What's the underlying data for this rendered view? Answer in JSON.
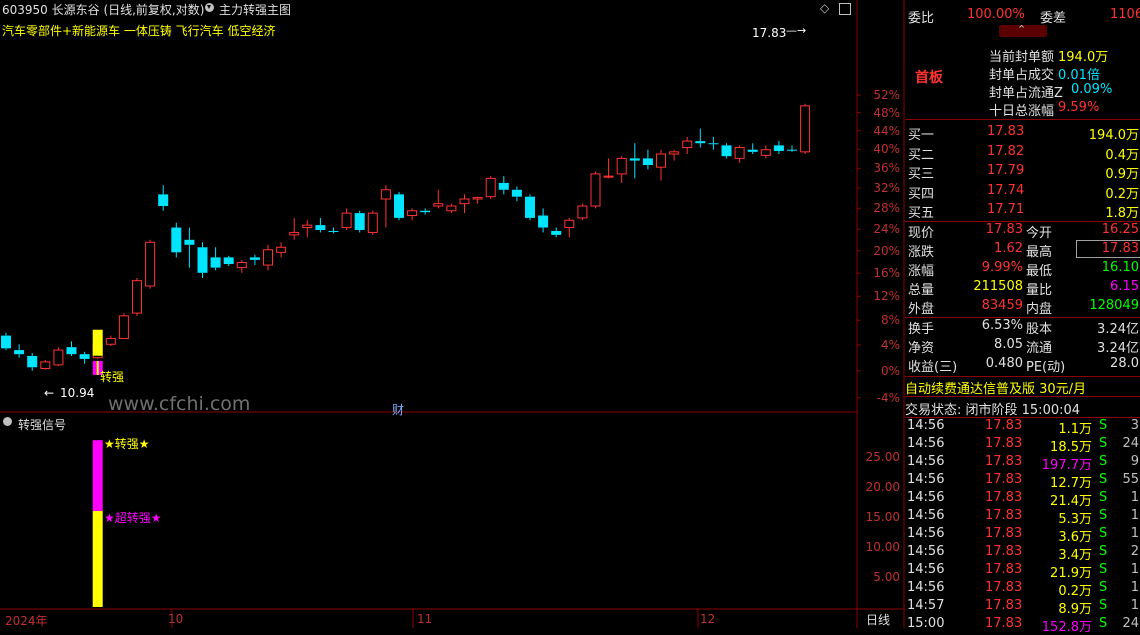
{
  "header": {
    "code_title": "603950 长源东谷 (日线,前复权,对数)",
    "indicator_name": "主力转强主图",
    "concepts": "汽车零部件+新能源车 一体压铸 飞行汽车 低空经济",
    "top_price_label": "17.83",
    "low_price_label": "10.94",
    "zhuanqiang_label": "转强",
    "watermark": "www.cfchi.com",
    "cai_marker": "财"
  },
  "price_axis": [
    "52%",
    "48%",
    "44%",
    "40%",
    "36%",
    "32%",
    "28%",
    "24%",
    "20%",
    "16%",
    "12%",
    "8%",
    "4%",
    "0%",
    "-4%"
  ],
  "sub_panel": {
    "title": "转强信号",
    "label_zhuanqiang": "★转强★",
    "label_chao": "★超转强★",
    "axis": [
      "25.00",
      "20.00",
      "15.00",
      "10.00",
      "5.00"
    ]
  },
  "x_axis": {
    "labels": [
      "2024年",
      "10",
      "11",
      "12"
    ],
    "period": "日线"
  },
  "colors": {
    "up": "#ff3232",
    "down": "#00e5ff",
    "signal_yellow": "#ffff00",
    "signal_magenta": "#ff00ff",
    "grid": "#8b0000"
  },
  "chart_data": {
    "type": "candlestick",
    "scale": "log",
    "ylim": [
      10.35,
      18.4
    ],
    "base_price": 10.9,
    "candles": [
      {
        "o": 11.5,
        "h": 11.55,
        "l": 11.25,
        "c": 11.28
      },
      {
        "o": 11.25,
        "h": 11.35,
        "l": 11.12,
        "c": 11.18
      },
      {
        "o": 11.15,
        "h": 11.2,
        "l": 10.9,
        "c": 10.96
      },
      {
        "o": 10.94,
        "h": 11.08,
        "l": 10.92,
        "c": 11.05
      },
      {
        "o": 11.0,
        "h": 11.3,
        "l": 10.98,
        "c": 11.25
      },
      {
        "o": 11.3,
        "h": 11.4,
        "l": 11.15,
        "c": 11.18
      },
      {
        "o": 11.18,
        "h": 11.22,
        "l": 11.02,
        "c": 11.1
      },
      {
        "o": 11.12,
        "h": 11.4,
        "l": 11.1,
        "c": 11.35
      },
      {
        "o": 11.35,
        "h": 11.5,
        "l": 11.32,
        "c": 11.45
      },
      {
        "o": 11.45,
        "h": 11.9,
        "l": 11.44,
        "c": 11.85
      },
      {
        "o": 11.9,
        "h": 12.55,
        "l": 11.85,
        "c": 12.5
      },
      {
        "o": 12.4,
        "h": 13.3,
        "l": 12.35,
        "c": 13.25
      },
      {
        "o": 14.25,
        "h": 14.45,
        "l": 13.9,
        "c": 14.0
      },
      {
        "o": 13.55,
        "h": 13.65,
        "l": 12.95,
        "c": 13.05
      },
      {
        "o": 13.3,
        "h": 13.55,
        "l": 12.75,
        "c": 13.2
      },
      {
        "o": 13.15,
        "h": 13.25,
        "l": 12.55,
        "c": 12.65
      },
      {
        "o": 12.95,
        "h": 13.15,
        "l": 12.7,
        "c": 12.75
      },
      {
        "o": 12.95,
        "h": 12.98,
        "l": 12.78,
        "c": 12.82
      },
      {
        "o": 12.75,
        "h": 12.9,
        "l": 12.65,
        "c": 12.85
      },
      {
        "o": 12.95,
        "h": 13.0,
        "l": 12.8,
        "c": 12.9
      },
      {
        "o": 12.8,
        "h": 13.2,
        "l": 12.7,
        "c": 13.1
      },
      {
        "o": 13.05,
        "h": 13.25,
        "l": 12.95,
        "c": 13.15
      },
      {
        "o": 13.4,
        "h": 13.75,
        "l": 13.3,
        "c": 13.45
      },
      {
        "o": 13.55,
        "h": 13.7,
        "l": 13.35,
        "c": 13.6
      },
      {
        "o": 13.6,
        "h": 13.75,
        "l": 13.45,
        "c": 13.5
      },
      {
        "o": 13.48,
        "h": 13.55,
        "l": 13.43,
        "c": 13.46
      },
      {
        "o": 13.55,
        "h": 13.95,
        "l": 13.5,
        "c": 13.85
      },
      {
        "o": 13.85,
        "h": 13.9,
        "l": 13.45,
        "c": 13.5
      },
      {
        "o": 13.45,
        "h": 13.9,
        "l": 13.4,
        "c": 13.85
      },
      {
        "o": 14.15,
        "h": 14.45,
        "l": 13.55,
        "c": 14.35
      },
      {
        "o": 14.25,
        "h": 14.3,
        "l": 13.7,
        "c": 13.75
      },
      {
        "o": 13.8,
        "h": 13.95,
        "l": 13.7,
        "c": 13.9
      },
      {
        "o": 13.9,
        "h": 13.95,
        "l": 13.82,
        "c": 13.87
      },
      {
        "o": 14.0,
        "h": 14.35,
        "l": 13.95,
        "c": 14.05
      },
      {
        "o": 13.9,
        "h": 14.05,
        "l": 13.85,
        "c": 14.0
      },
      {
        "o": 14.05,
        "h": 14.25,
        "l": 13.85,
        "c": 14.15
      },
      {
        "o": 14.15,
        "h": 14.2,
        "l": 14.05,
        "c": 14.18
      },
      {
        "o": 14.2,
        "h": 14.65,
        "l": 14.15,
        "c": 14.6
      },
      {
        "o": 14.5,
        "h": 14.65,
        "l": 14.25,
        "c": 14.35
      },
      {
        "o": 14.35,
        "h": 14.42,
        "l": 14.1,
        "c": 14.2
      },
      {
        "o": 14.2,
        "h": 14.25,
        "l": 13.7,
        "c": 13.75
      },
      {
        "o": 13.8,
        "h": 13.95,
        "l": 13.45,
        "c": 13.55
      },
      {
        "o": 13.48,
        "h": 13.55,
        "l": 13.35,
        "c": 13.4
      },
      {
        "o": 13.55,
        "h": 13.75,
        "l": 13.35,
        "c": 13.7
      },
      {
        "o": 13.75,
        "h": 14.05,
        "l": 13.7,
        "c": 14.0
      },
      {
        "o": 14.0,
        "h": 14.75,
        "l": 13.95,
        "c": 14.7
      },
      {
        "o": 14.65,
        "h": 15.05,
        "l": 14.6,
        "c": 14.65
      },
      {
        "o": 14.7,
        "h": 15.1,
        "l": 14.5,
        "c": 15.05
      },
      {
        "o": 15.05,
        "h": 15.4,
        "l": 14.6,
        "c": 15.0
      },
      {
        "o": 15.05,
        "h": 15.25,
        "l": 14.8,
        "c": 14.9
      },
      {
        "o": 14.85,
        "h": 15.25,
        "l": 14.55,
        "c": 15.15
      },
      {
        "o": 15.15,
        "h": 15.25,
        "l": 15.0,
        "c": 15.2
      },
      {
        "o": 15.3,
        "h": 15.55,
        "l": 15.15,
        "c": 15.45
      },
      {
        "o": 15.45,
        "h": 15.75,
        "l": 15.3,
        "c": 15.4
      },
      {
        "o": 15.4,
        "h": 15.55,
        "l": 15.25,
        "c": 15.38
      },
      {
        "o": 15.35,
        "h": 15.4,
        "l": 15.05,
        "c": 15.1
      },
      {
        "o": 15.05,
        "h": 15.35,
        "l": 14.95,
        "c": 15.3
      },
      {
        "o": 15.25,
        "h": 15.4,
        "l": 15.15,
        "c": 15.2
      },
      {
        "o": 15.12,
        "h": 15.35,
        "l": 15.05,
        "c": 15.25
      },
      {
        "o": 15.35,
        "h": 15.45,
        "l": 15.15,
        "c": 15.22
      },
      {
        "o": 15.25,
        "h": 15.35,
        "l": 15.2,
        "c": 15.23
      },
      {
        "o": 15.2,
        "h": 16.35,
        "l": 15.15,
        "c": 16.3
      }
    ],
    "signals": [
      {
        "index": 7,
        "zhuanqiang": 1
      }
    ],
    "sub_chart": {
      "type": "bar",
      "index": 7,
      "yellow_value": 16.0,
      "magenta_value": 27.8,
      "ylim": [
        0,
        29.5
      ]
    }
  },
  "right_panel": {
    "weibi_label": "委比",
    "weibi_value": "100.00%",
    "weicha_label": "委差",
    "weicha_value": "1106",
    "shouban_label": "首板",
    "seal": [
      {
        "label": "当前封单额",
        "value": "194.0万"
      },
      {
        "label": "封单占成交",
        "value": "0.01倍"
      },
      {
        "label": "封单占流通Z",
        "value": "0.09%"
      },
      {
        "label": "十日总涨幅",
        "value": "9.59%"
      }
    ],
    "bids": [
      {
        "label": "买一",
        "price": "17.83",
        "vol": "194.0万"
      },
      {
        "label": "买二",
        "price": "17.82",
        "vol": "0.4万"
      },
      {
        "label": "买三",
        "price": "17.79",
        "vol": "0.9万"
      },
      {
        "label": "买四",
        "price": "17.74",
        "vol": "0.2万"
      },
      {
        "label": "买五",
        "price": "17.71",
        "vol": "1.8万"
      }
    ],
    "quote": [
      {
        "l1": "现价",
        "v1": "17.83",
        "l2": "今开",
        "v2": "16.25"
      },
      {
        "l1": "涨跌",
        "v1": "1.62",
        "l2": "最高",
        "v2": "17.83"
      },
      {
        "l1": "涨幅",
        "v1": "9.99%",
        "l2": "最低",
        "v2": "16.10"
      },
      {
        "l1": "总量",
        "v1": "211508",
        "l2": "量比",
        "v2": "6.15"
      },
      {
        "l1": "外盘",
        "v1": "83459",
        "l2": "内盘",
        "v2": "128049"
      }
    ],
    "fund": [
      {
        "l1": "换手",
        "v1": "6.53%",
        "l2": "股本",
        "v2": "3.24亿"
      },
      {
        "l1": "净资",
        "v1": "8.05",
        "l2": "流通",
        "v2": "3.24亿"
      },
      {
        "l1": "收益(三)",
        "v1": "0.480",
        "l2": "PE(动)",
        "v2": "28.0"
      }
    ],
    "ad_text": "自动续费通达信普及版  30元/月",
    "status_text": "交易状态: 闭市阶段 15:00:04",
    "trades": [
      {
        "t": "14:56",
        "p": "17.83",
        "v": "1.1万",
        "s": "S",
        "n": "3"
      },
      {
        "t": "14:56",
        "p": "17.83",
        "v": "18.5万",
        "s": "S",
        "n": "24"
      },
      {
        "t": "14:56",
        "p": "17.83",
        "v": "197.7万",
        "s": "S",
        "n": "9"
      },
      {
        "t": "14:56",
        "p": "17.83",
        "v": "12.7万",
        "s": "S",
        "n": "55"
      },
      {
        "t": "14:56",
        "p": "17.83",
        "v": "21.4万",
        "s": "S",
        "n": "1"
      },
      {
        "t": "14:56",
        "p": "17.83",
        "v": "5.3万",
        "s": "S",
        "n": "1"
      },
      {
        "t": "14:56",
        "p": "17.83",
        "v": "3.6万",
        "s": "S",
        "n": "1"
      },
      {
        "t": "14:56",
        "p": "17.83",
        "v": "3.4万",
        "s": "S",
        "n": "2"
      },
      {
        "t": "14:56",
        "p": "17.83",
        "v": "21.9万",
        "s": "S",
        "n": "1"
      },
      {
        "t": "14:56",
        "p": "17.83",
        "v": "0.2万",
        "s": "S",
        "n": "1"
      },
      {
        "t": "14:57",
        "p": "17.83",
        "v": "8.9万",
        "s": "S",
        "n": "1"
      },
      {
        "t": "15:00",
        "p": "17.83",
        "v": "152.8万",
        "s": "S",
        "n": "24"
      }
    ]
  }
}
